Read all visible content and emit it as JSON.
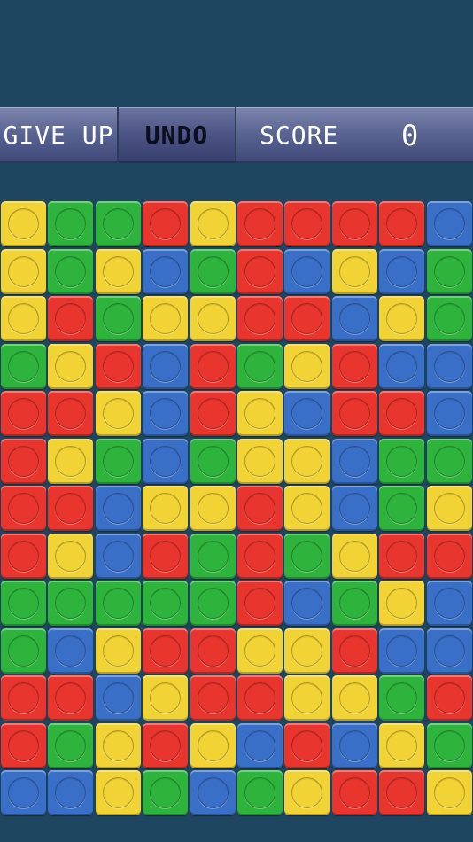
{
  "toolbar": {
    "give_up_label": "GIVE UP",
    "undo_label": "UNDO",
    "score_label": "SCORE",
    "score_value": "0"
  },
  "colors": {
    "Y": "#f1d336",
    "G": "#2eb43c",
    "R": "#e8352d",
    "B": "#3a6fc7"
  },
  "board": {
    "rows": 13,
    "cols": 10,
    "cells": [
      [
        "Y",
        "G",
        "G",
        "R",
        "Y",
        "R",
        "R",
        "R",
        "R",
        "B"
      ],
      [
        "Y",
        "G",
        "Y",
        "B",
        "G",
        "R",
        "B",
        "Y",
        "B",
        "G"
      ],
      [
        "Y",
        "R",
        "G",
        "Y",
        "Y",
        "R",
        "R",
        "B",
        "Y",
        "G"
      ],
      [
        "G",
        "Y",
        "R",
        "B",
        "R",
        "G",
        "Y",
        "R",
        "B",
        "B"
      ],
      [
        "R",
        "R",
        "Y",
        "B",
        "R",
        "Y",
        "B",
        "R",
        "R",
        "B"
      ],
      [
        "R",
        "Y",
        "G",
        "B",
        "G",
        "Y",
        "Y",
        "B",
        "G",
        "G"
      ],
      [
        "R",
        "R",
        "B",
        "Y",
        "Y",
        "R",
        "Y",
        "B",
        "G",
        "Y"
      ],
      [
        "R",
        "Y",
        "B",
        "R",
        "G",
        "R",
        "G",
        "Y",
        "R",
        "R"
      ],
      [
        "G",
        "G",
        "G",
        "G",
        "G",
        "R",
        "B",
        "G",
        "Y",
        "B"
      ],
      [
        "G",
        "B",
        "Y",
        "R",
        "R",
        "Y",
        "Y",
        "R",
        "B",
        "B"
      ],
      [
        "R",
        "R",
        "B",
        "Y",
        "R",
        "R",
        "Y",
        "Y",
        "G",
        "R"
      ],
      [
        "R",
        "G",
        "Y",
        "R",
        "Y",
        "B",
        "R",
        "B",
        "Y",
        "G"
      ],
      [
        "B",
        "B",
        "Y",
        "G",
        "B",
        "G",
        "Y",
        "R",
        "R",
        "Y"
      ]
    ]
  }
}
